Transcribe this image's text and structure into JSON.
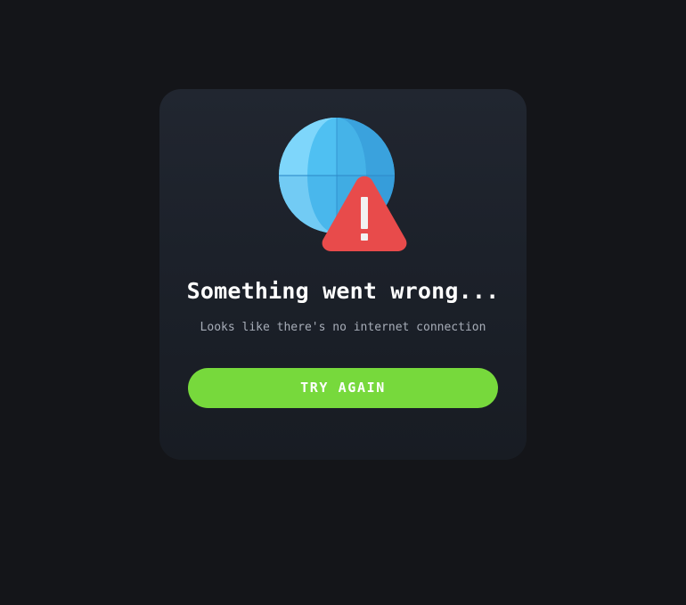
{
  "error_card": {
    "illustration_icon": "globe-warning-icon",
    "title": "Something went wrong...",
    "message": "Looks like there's no internet connection",
    "retry_label": "TRY AGAIN"
  },
  "colors": {
    "background": "#141519",
    "card": "#1e222b",
    "button": "#77d93c",
    "globe": "#4bb8ec",
    "warning": "#e84b4b",
    "subtitle": "#a7adb8"
  }
}
